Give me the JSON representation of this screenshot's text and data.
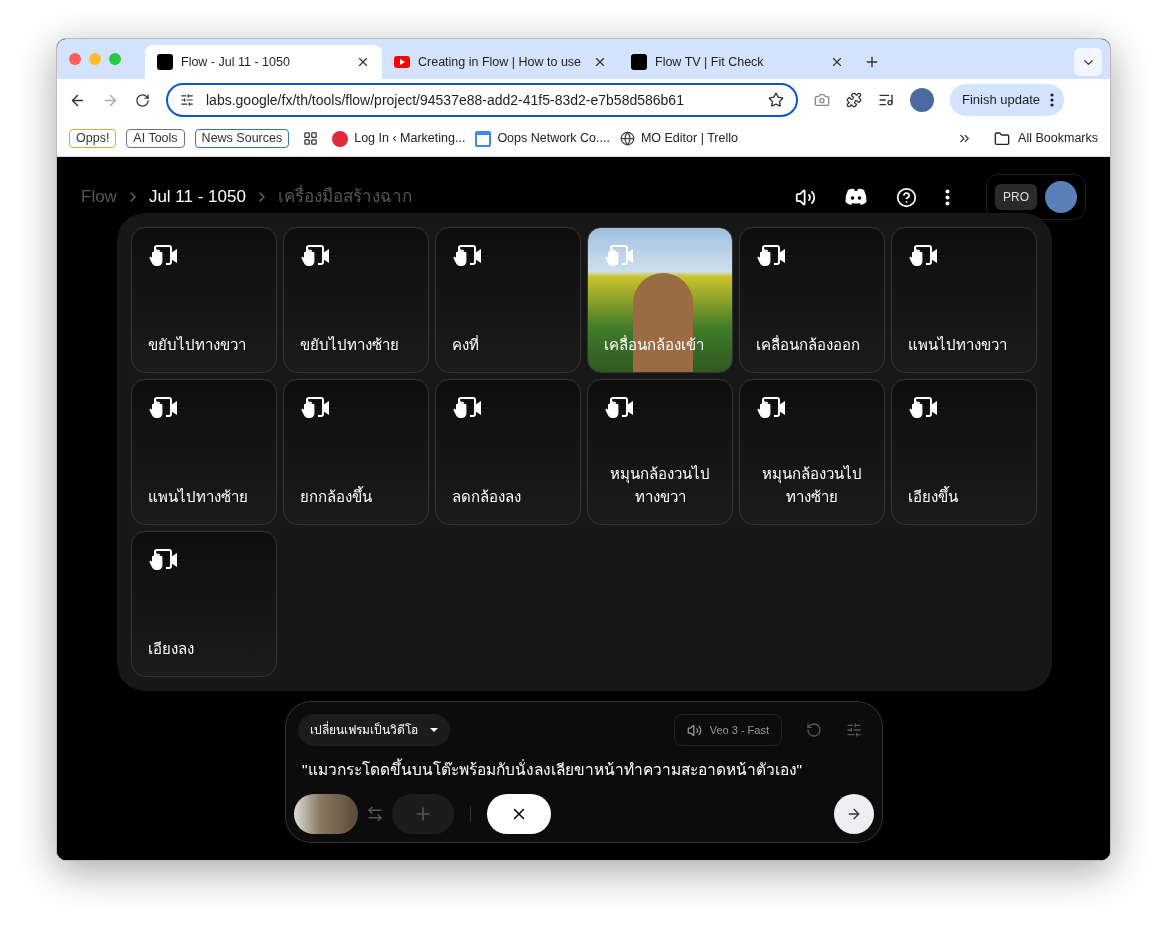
{
  "browser": {
    "tabs": [
      {
        "title": "Flow - Jul 11 - 1050",
        "selected": true,
        "kind": "dark"
      },
      {
        "title": "Creating in Flow | How to use",
        "selected": false,
        "kind": "video"
      },
      {
        "title": "Flow TV | Fit Check",
        "selected": false,
        "kind": "dark"
      }
    ],
    "url": "labs.google/fx/th/tools/flow/project/94537e88-add2-41f5-83d2-e7b58d586b61",
    "update_button": "Finish update",
    "bookmarks": [
      {
        "label": "Opps!",
        "kind": "chip",
        "color": "#e8a33c"
      },
      {
        "label": "AI Tools",
        "kind": "chip",
        "color": "#6b7280"
      },
      {
        "label": "News Sources",
        "kind": "chip",
        "color": "#2f6fd6"
      },
      {
        "kind": "apps"
      },
      {
        "label": "Log In ‹ Marketing...",
        "kind": "site"
      },
      {
        "label": "Oops Network Co....",
        "kind": "calendar"
      },
      {
        "label": "MO Editor | Trello",
        "kind": "globe"
      }
    ],
    "all_bookmarks": "All Bookmarks"
  },
  "app": {
    "breadcrumb": [
      "Flow",
      "Jul 11 - 1050",
      "เครื่องมือสร้างฉาก"
    ],
    "plan_badge": "PRO",
    "camera_motions": [
      {
        "label": "ขยับไปทางขวา",
        "selected": false
      },
      {
        "label": "ขยับไปทางซ้าย",
        "selected": false
      },
      {
        "label": "คงที่",
        "selected": false
      },
      {
        "label": "เคลื่อนกล้องเข้า",
        "selected": true
      },
      {
        "label": "เคลื่อนกล้องออก",
        "selected": false
      },
      {
        "label": "แพนไปทางขวา",
        "selected": false
      },
      {
        "label": "แพนไปทางซ้าย",
        "selected": false
      },
      {
        "label": "ยกกล้องขึ้น",
        "selected": false
      },
      {
        "label": "ลดกล้องลง",
        "selected": false
      },
      {
        "label": "หมุนกล้องวนไปทางขวา",
        "selected": false
      },
      {
        "label": "หมุนกล้องวนไปทางซ้าย",
        "selected": false
      },
      {
        "label": "เอียงขึ้น",
        "selected": false
      },
      {
        "label": "เอียงลง",
        "selected": false
      }
    ],
    "prompt": {
      "mode": "เปลี่ยนเฟรมเป็นวิดีโอ",
      "model": "Veo 3 - Fast",
      "text": "\"แมวกระโดดขึ้นบนโต๊ะพร้อมกับนั่งลงเลียขาหน้าทำความสะอาดหน้าตัวเอง\""
    }
  }
}
